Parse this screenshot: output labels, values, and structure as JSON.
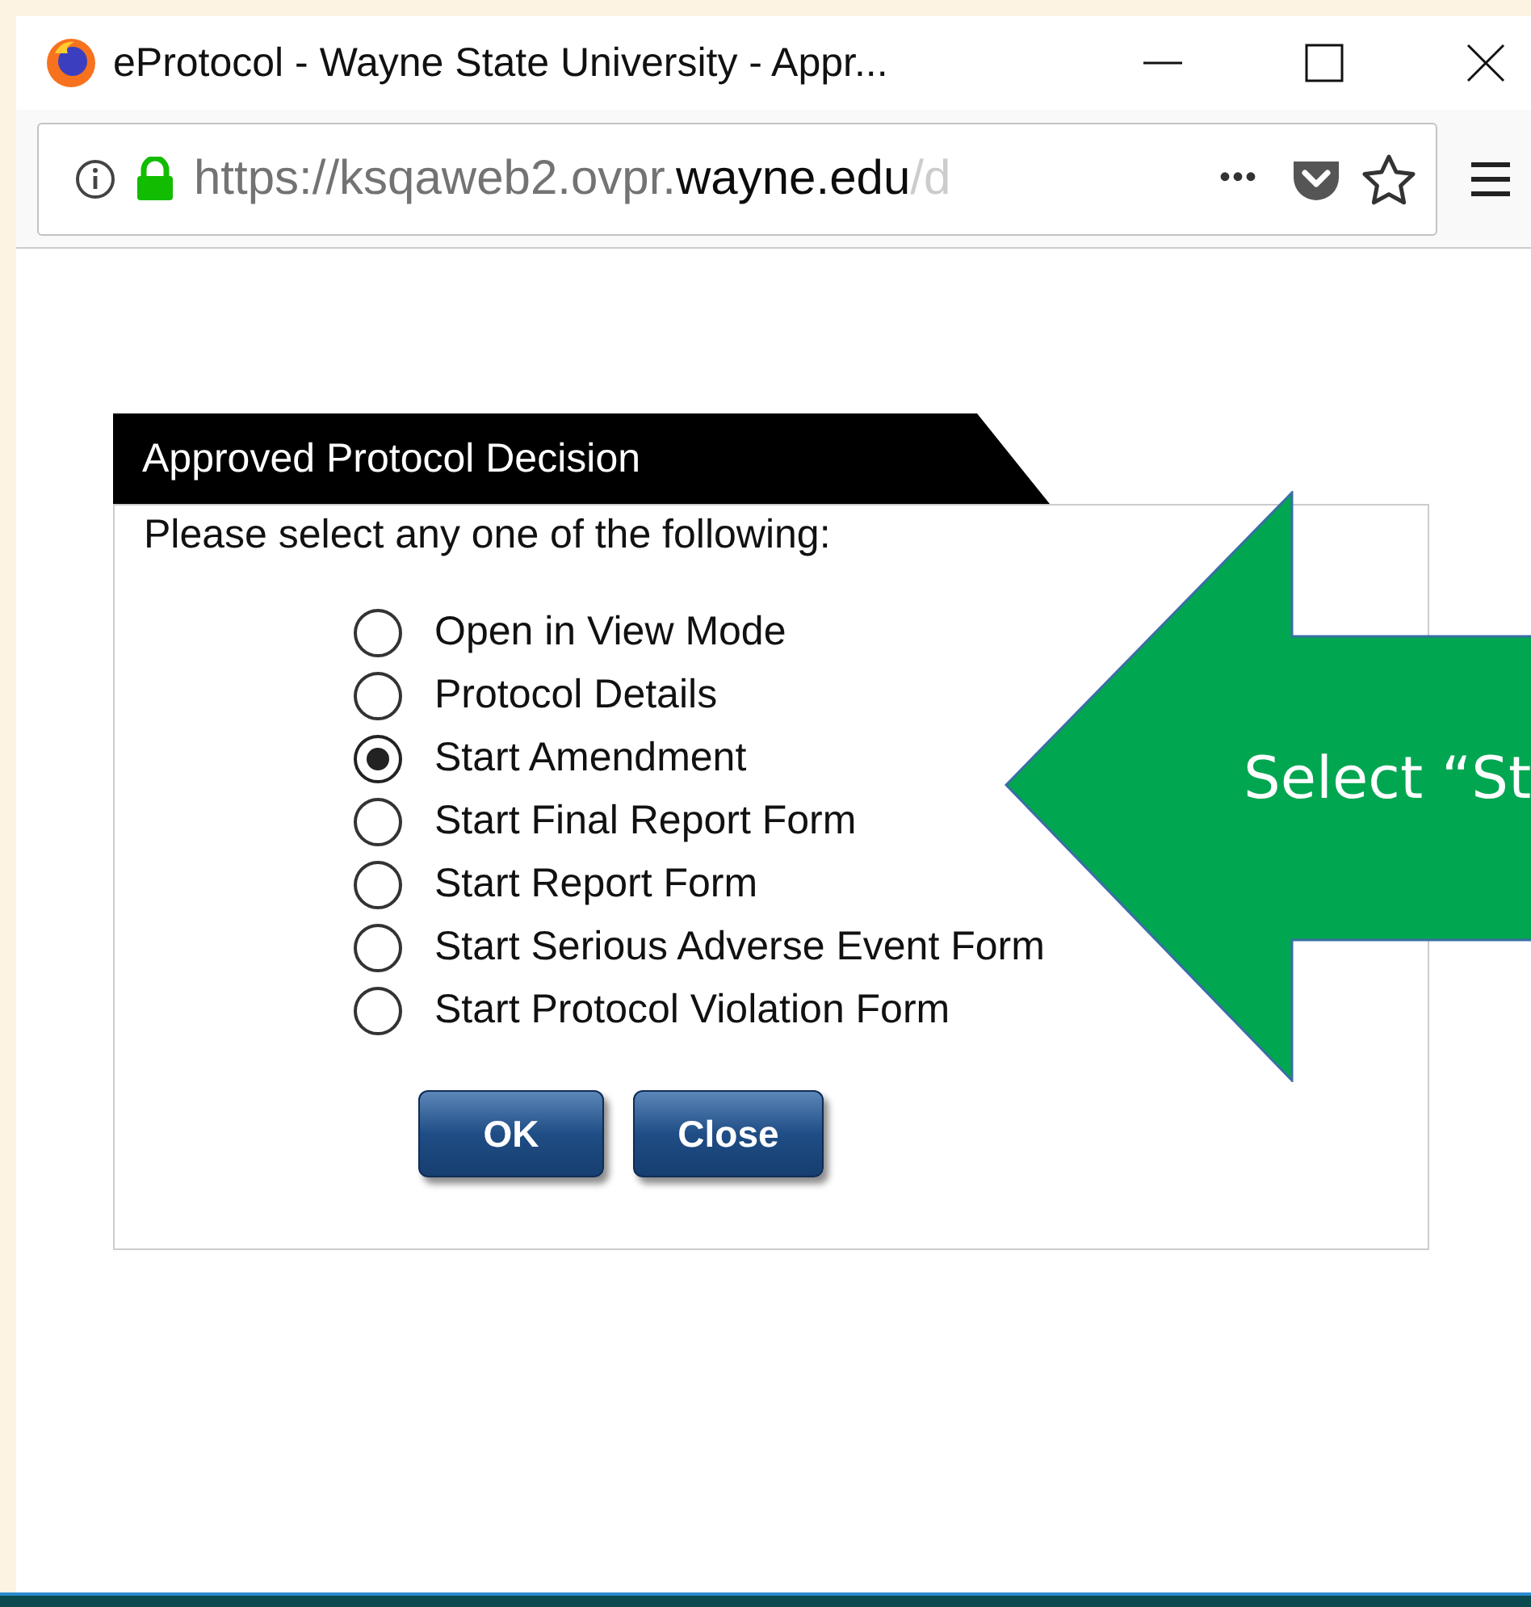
{
  "window": {
    "title": "eProtocol - Wayne State University - Appr..."
  },
  "address_bar": {
    "url_prefix": "https://ksqaweb2.ovpr.",
    "url_domain": "wayne.edu",
    "url_suffix": "/d",
    "menu_dots": "•••"
  },
  "dialog": {
    "title": "Approved Protocol Decision",
    "prompt": "Please select any one of the following:",
    "options": [
      {
        "label": "Open in View Mode",
        "selected": false
      },
      {
        "label": "Protocol Details",
        "selected": false
      },
      {
        "label": "Start Amendment",
        "selected": true
      },
      {
        "label": "Start Final Report Form",
        "selected": false
      },
      {
        "label": "Start Report Form",
        "selected": false
      },
      {
        "label": "Start Serious Adverse Event Form",
        "selected": false
      },
      {
        "label": "Start Protocol Violation Form",
        "selected": false
      }
    ],
    "buttons": [
      "OK",
      "Close"
    ]
  },
  "callout": {
    "text": "Select “St"
  }
}
